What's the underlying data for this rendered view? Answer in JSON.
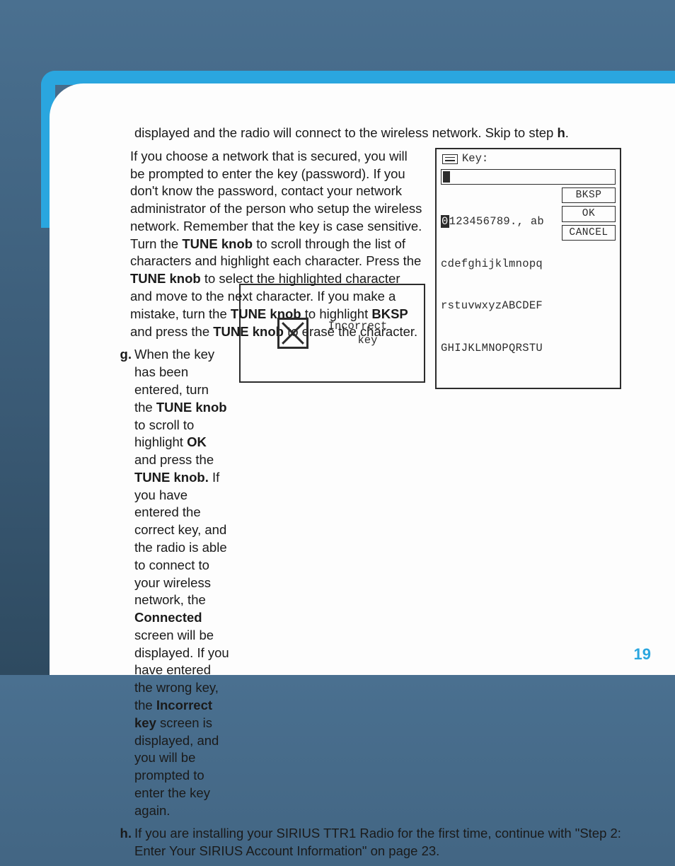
{
  "page_number": "19",
  "intro": {
    "line1_a": "displayed and the radio will connect to the wireless network. Skip to step ",
    "line1_bold": "h",
    "line1_b": "."
  },
  "key_screen": {
    "title": "Key:",
    "row1_hl": "0",
    "row1_rest": "123456789., ab",
    "row2": "cdefghijklmnopq",
    "row3": "rstuvwxyzABCDEF",
    "row4": "GHIJKLMNOPQRSTU",
    "buttons": {
      "bksp": "BKSP",
      "ok": "OK",
      "cancel": "CANCEL"
    }
  },
  "secured": {
    "p1_a": "If you choose a network that is secured, you will be prompted to enter the key (password). If you don't know the password, contact your network administrator of the person who setup the wireless network. Remember that the key is case sensitive. Turn the ",
    "p1_b1": "TUNE knob",
    "p1_c": " to scroll through the list of characters and highlight each character. Press the ",
    "p1_b2": "TUNE knob",
    "p1_d": " to select the highlighted character and move to the next character. If you make a mistake, turn the ",
    "p1_b3": "TUNE knob",
    "p1_e": " to highlight ",
    "p1_b4": "BKSP",
    "p1_f": " and press the ",
    "p1_b5": "TUNE knob",
    "p1_g": " to erase the character."
  },
  "err_screen": {
    "text": "Incorrect\n   key"
  },
  "step_g": {
    "label": "g.",
    "a": "When the key has been entered, turn the ",
    "b1": "TUNE knob",
    "c": " to scroll to highlight ",
    "b2": "OK",
    "d": " and press the ",
    "b3": "TUNE knob.",
    "e": " If you have entered the correct key, and the radio is able to connect to your wireless network, the ",
    "b4": "Connected",
    "f": " screen will be displayed. If you have entered the wrong key, the ",
    "b5": "Incorrect key",
    "g": " screen is displayed, and you will be prompted to enter the key again."
  },
  "step_h": {
    "label": "h.",
    "text": "If you are installing your SIRIUS TTR1 Radio for the first time, continue with \"Step 2: Enter Your SIRIUS Account Information\" on page 23."
  }
}
